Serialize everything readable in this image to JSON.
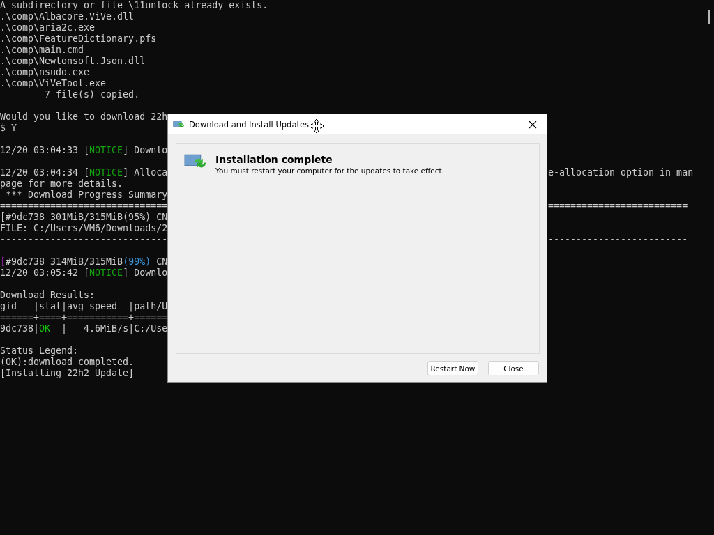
{
  "terminal": {
    "lines": [
      {
        "text": "A subdirectory or file \\11unlock already exists."
      },
      {
        "text": ".\\comp\\Albacore.ViVe.dll"
      },
      {
        "text": ".\\comp\\aria2c.exe"
      },
      {
        "text": ".\\comp\\FeatureDictionary.pfs"
      },
      {
        "text": ".\\comp\\main.cmd"
      },
      {
        "text": ".\\comp\\Newtonsoft.Json.dll"
      },
      {
        "text": ".\\comp\\nsudo.exe"
      },
      {
        "text": ".\\comp\\ViVeTool.exe"
      },
      {
        "text": "        7 file(s) copied."
      },
      {
        "blank": true
      },
      {
        "text": "Would you like to download 22h"
      },
      {
        "text": "$ Y"
      },
      {
        "blank": true
      },
      {
        "parts": [
          {
            "text": "12/20 03:04:33 [",
            "kind": "plain"
          },
          {
            "text": "NOTICE",
            "kind": "notice"
          },
          {
            "text": "] Downlo",
            "kind": "plain"
          }
        ]
      },
      {
        "blank": true
      },
      {
        "parts": [
          {
            "text": "12/20 03:04:34 [",
            "kind": "plain"
          },
          {
            "text": "NOTICE",
            "kind": "notice"
          },
          {
            "text": "] Alloca",
            "kind": "plain"
          }
        ],
        "right": "e-allocation option in man"
      },
      {
        "text": "page for more details."
      },
      {
        "text": " *** Download Progress Summary"
      },
      {
        "text": "==============================",
        "right": "========================="
      },
      {
        "text": "[#9dc738 301MiB/315MiB(95%) CN"
      },
      {
        "text": "FILE: C:/Users/VM6/Downloads/2"
      },
      {
        "text": "------------------------------",
        "right": "-------------------------"
      },
      {
        "blank": true
      },
      {
        "parts": [
          {
            "text": "[",
            "kind": "bracket"
          },
          {
            "text": "#9dc738 314MiB/315MiB",
            "kind": "plain"
          },
          {
            "text": "(99%)",
            "kind": "percent"
          },
          {
            "text": " CN",
            "kind": "plain"
          }
        ]
      },
      {
        "parts": [
          {
            "text": "12/20 03:05:42 [",
            "kind": "plain"
          },
          {
            "text": "NOTICE",
            "kind": "notice"
          },
          {
            "text": "] Downlo",
            "kind": "plain"
          }
        ]
      },
      {
        "blank": true
      },
      {
        "text": "Download Results:"
      },
      {
        "text": "gid   |stat|avg speed  |path/U"
      },
      {
        "text": "======+====+===========+======"
      },
      {
        "parts": [
          {
            "text": "9dc738|",
            "kind": "plain"
          },
          {
            "text": "OK",
            "kind": "ok"
          },
          {
            "text": "  |   4.6MiB/s|C:/Use",
            "kind": "plain"
          }
        ]
      },
      {
        "blank": true
      },
      {
        "text": "Status Legend:"
      },
      {
        "text": "(OK):download completed."
      },
      {
        "text": "[Installing 22h2 Update]"
      }
    ]
  },
  "dialog": {
    "title": "Download and Install Updates",
    "heading": "Installation complete",
    "message": "You must restart your computer for the updates to take effect.",
    "buttons": [
      {
        "label": "Restart Now"
      },
      {
        "label": "Close"
      }
    ]
  }
}
